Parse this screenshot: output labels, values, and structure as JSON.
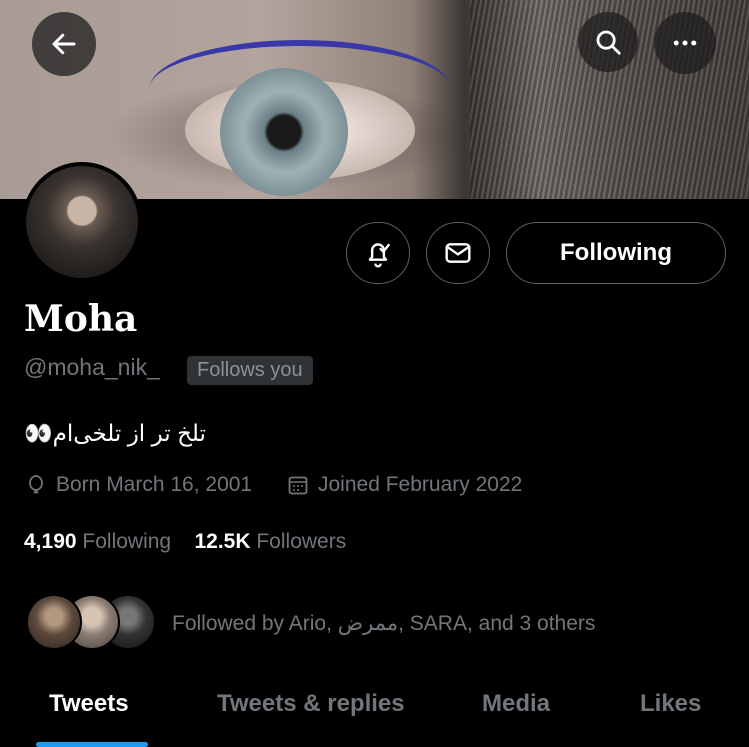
{
  "header": {
    "back_icon": "arrow-left-icon",
    "search_icon": "search-icon",
    "more_icon": "more-horizontal-icon"
  },
  "profile": {
    "name": "Moha",
    "handle": "@moha_nik_",
    "follows_you": "Follows you",
    "bio_text": "تلخ تر از تلخی‌ام",
    "bio_emoji": "👀",
    "born": "Born March 16, 2001",
    "joined": "Joined February 2022",
    "following_count": "4,190",
    "following_label": "Following",
    "followers_count": "12.5K",
    "followers_label": "Followers",
    "followed_by": "Followed by Ario, ممرض, SARA, and 3 others"
  },
  "actions": {
    "notify_icon": "bell-check-icon",
    "message_icon": "mail-icon",
    "following_label": "Following"
  },
  "tabs": [
    {
      "label": "Tweets",
      "active": true
    },
    {
      "label": "Tweets & replies",
      "active": false
    },
    {
      "label": "Media",
      "active": false
    },
    {
      "label": "Likes",
      "active": false
    }
  ],
  "colors": {
    "background": "#000000",
    "accent": "#1d9bf0",
    "muted_text": "#71767b"
  }
}
